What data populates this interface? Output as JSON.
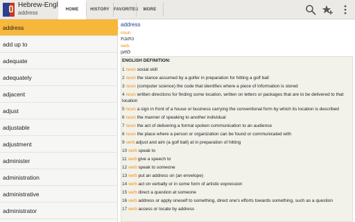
{
  "app": {
    "title": "Hebrew-English",
    "subtitle": "address"
  },
  "tabs": [
    {
      "label": "HOME",
      "active": true
    },
    {
      "label": "HISTORY",
      "active": false
    },
    {
      "label": "FAVORITES",
      "active": false
    },
    {
      "label": "MORE",
      "active": false
    }
  ],
  "actions": [
    "search-icon",
    "star-add-icon",
    "overflow-menu-icon"
  ],
  "word_list": [
    "address",
    "add up to",
    "adequate",
    "adequately",
    "adjacent",
    "adjust",
    "adjustable",
    "adjustment",
    "administer",
    "administration",
    "administrative",
    "administrator"
  ],
  "selected_index": 0,
  "entry": {
    "word": "address",
    "pos1": "noun",
    "hebrew1": "כתובת",
    "pos2": "verb",
    "hebrew2": "למען",
    "definition_heading": "ENGLISH DEFINITION:"
  },
  "definitions": [
    {
      "n": "1",
      "pos": "noun",
      "text": "social skill"
    },
    {
      "n": "2",
      "pos": "noun",
      "text": "the stance assumed by a golfer in preparation for hitting a golf ball"
    },
    {
      "n": "3",
      "pos": "noun",
      "text": "(computer science) the code that identifies where a piece of information is stored"
    },
    {
      "n": "4",
      "pos": "noun",
      "text": "written directions for finding some location, written on letters or packages that are to be delivered to that location"
    },
    {
      "n": "5",
      "pos": "noun",
      "text": "a sign in front of a house or business carrying the conventional form by which its location is described"
    },
    {
      "n": "6",
      "pos": "noun",
      "text": "the manner of speaking to another individual"
    },
    {
      "n": "7",
      "pos": "noun",
      "text": "the act of delivering a formal spoken communication to an audience"
    },
    {
      "n": "8",
      "pos": "noun",
      "text": "the place where a person or organization can be found or communicated with"
    },
    {
      "n": "9",
      "pos": "verb",
      "text": "adjust and aim (a golf ball) at in preparation of hitting"
    },
    {
      "n": "10",
      "pos": "verb",
      "text": "speak to"
    },
    {
      "n": "11",
      "pos": "verb",
      "text": "give a speech to"
    },
    {
      "n": "12",
      "pos": "verb",
      "text": "speak to someone"
    },
    {
      "n": "13",
      "pos": "verb",
      "text": "put an address on (an envelope)"
    },
    {
      "n": "14",
      "pos": "verb",
      "text": "act on verbally or in some form of artistic expression"
    },
    {
      "n": "15",
      "pos": "verb",
      "text": "direct a question at someone"
    },
    {
      "n": "16",
      "pos": "verb",
      "text": "address or apply oneself to something, direct one's efforts towards something, such as a question"
    },
    {
      "n": "17",
      "pos": "verb",
      "text": "access or locate by address"
    }
  ]
}
